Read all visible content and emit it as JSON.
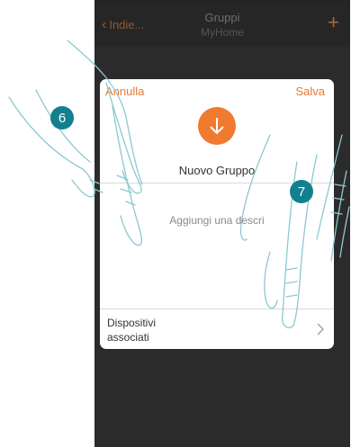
{
  "topbar": {
    "back_label": "Indie...",
    "title": "Gruppi",
    "subtitle": "MyHome",
    "add_icon": "plus-icon"
  },
  "card": {
    "cancel_label": "Annulla",
    "save_label": "Salva",
    "group_icon": "down-arrow-icon",
    "group_name": "Nuovo Gruppo",
    "description_placeholder": "Aggiungi una descri",
    "devices_label_line1": "Dispositivi",
    "devices_label_line2": "associati"
  },
  "annotations": {
    "step_a": "6",
    "step_b": "7"
  },
  "colors": {
    "accent": "#ef7a30",
    "badge": "#12808e",
    "phone_bg": "#2b2b2b"
  }
}
